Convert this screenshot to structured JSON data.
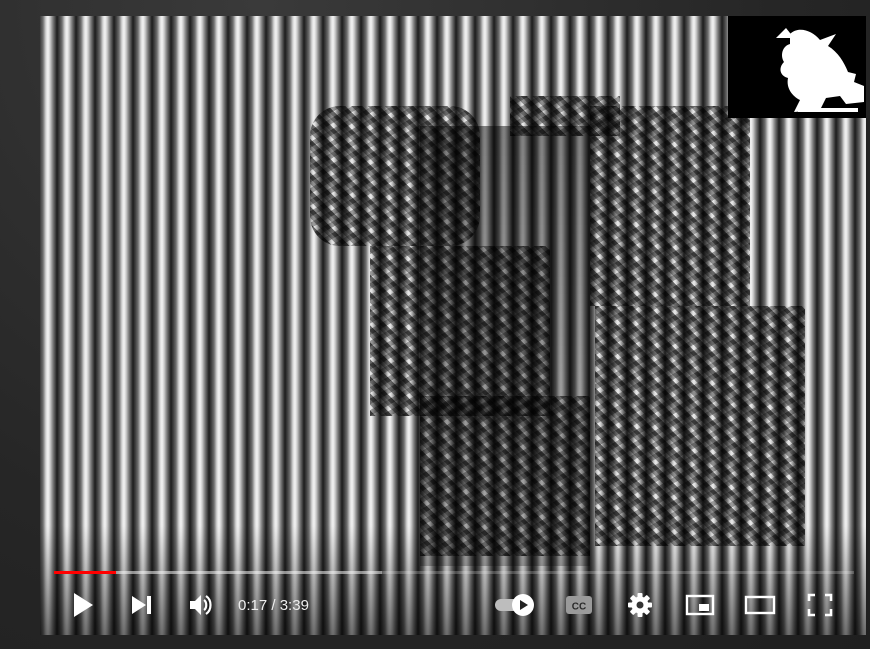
{
  "player": {
    "time_current": "0:17",
    "time_separator": " / ",
    "time_total": "3:39",
    "progress_played_fraction": 0.0776,
    "progress_buffered_fraction": 0.41,
    "autoplay_enabled": true,
    "accent_color": "#ff0000",
    "icons": {
      "play": "play-icon",
      "next": "skip-next-icon",
      "volume": "volume-icon",
      "autoplay": "autoplay-toggle-icon",
      "captions": "closed-captions-icon",
      "settings": "gear-icon",
      "miniplayer": "miniplayer-icon",
      "theater": "theater-mode-icon",
      "fullscreen": "fullscreen-icon"
    }
  }
}
